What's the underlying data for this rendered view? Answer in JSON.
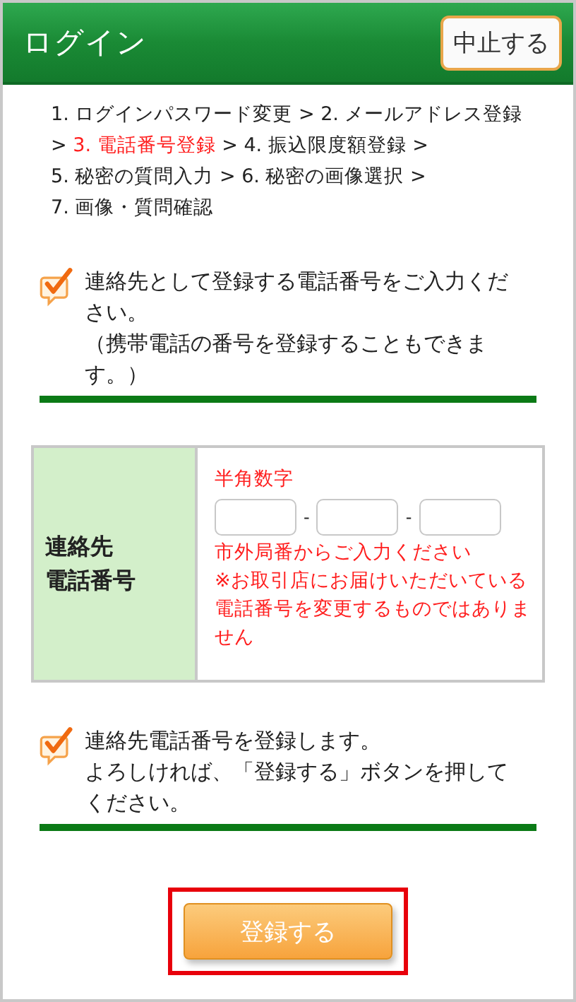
{
  "header": {
    "title": "ログイン",
    "cancel_button": "中止する"
  },
  "steps": {
    "separator": ">",
    "items": [
      {
        "label": "1. ログインパスワード変更",
        "selected": false
      },
      {
        "label": "2. メールアドレス登録",
        "selected": false
      },
      {
        "label": "3. 電話番号登録",
        "selected": true
      },
      {
        "label": "4. 振込限度額登録",
        "selected": false
      },
      {
        "label": "5. 秘密の質問入力",
        "selected": false
      },
      {
        "label": "6. 秘密の画像選択",
        "selected": false
      },
      {
        "label": "7. 画像・質問確認",
        "selected": false
      }
    ]
  },
  "notice_top": {
    "lines": [
      "連絡先として登録する電話番号をご入力ください。",
      "（携帯電話の番号を登録することもできます。）"
    ]
  },
  "form": {
    "label": [
      "連絡先",
      "電話番号"
    ],
    "format_hint": "半角数字",
    "separator": "-",
    "notes": [
      "市外局番からご入力ください",
      "※お取引店にお届けいただいている電話番号を変更するものではありません"
    ]
  },
  "notice_bottom": {
    "lines": [
      "連絡先電話番号を登録します。",
      "よろしければ、「登録する」ボタンを押してください。"
    ]
  },
  "submit": {
    "label": "登録する",
    "highlighted": true
  }
}
